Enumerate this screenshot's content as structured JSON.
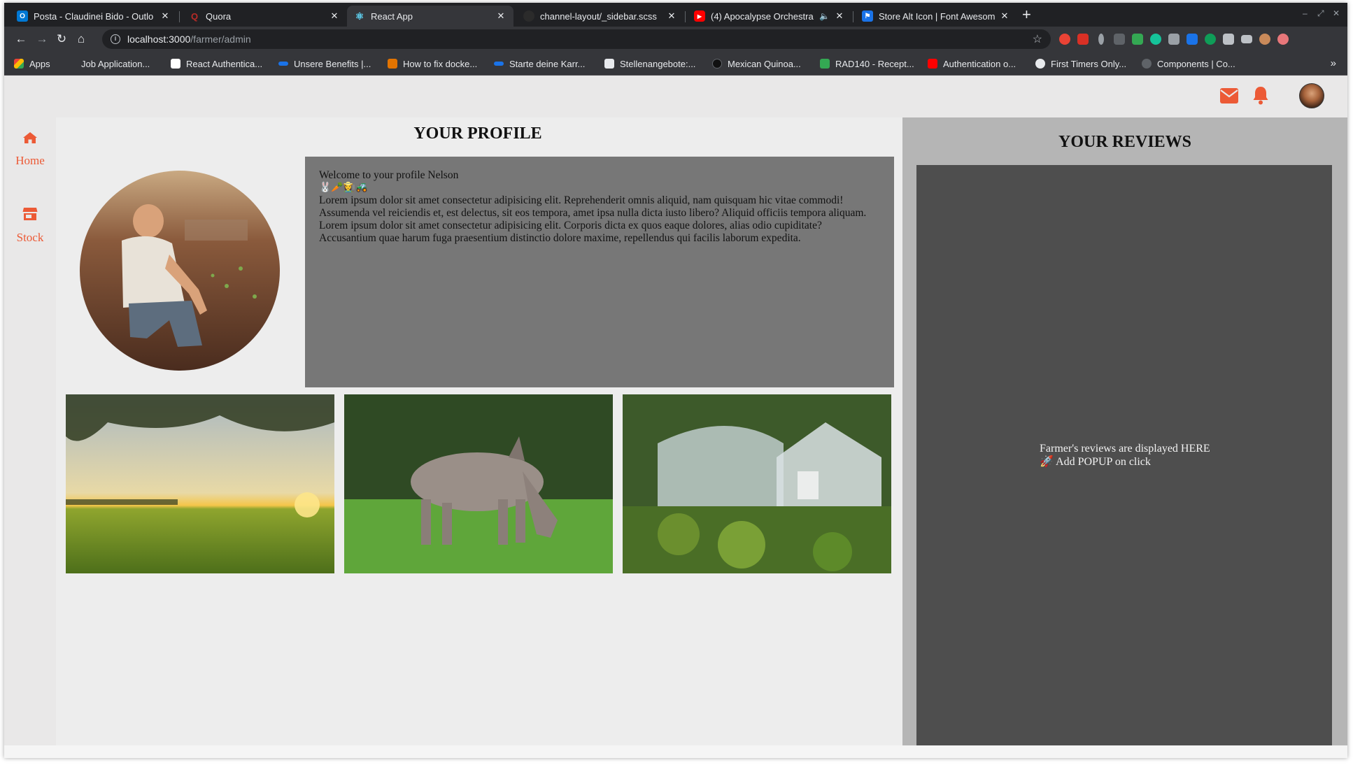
{
  "browser": {
    "tabs": [
      {
        "title": "Posta - Claudinei Bido - Outlo",
        "icon": "outlook-icon",
        "color": "#0078d4"
      },
      {
        "title": "Quora",
        "icon": "quora-icon",
        "color": "#b92b27"
      },
      {
        "title": "React App",
        "icon": "react-icon",
        "color": "#61dafb",
        "active": true
      },
      {
        "title": "channel-layout/_sidebar.scss",
        "icon": "github-icon",
        "color": "#24292e"
      },
      {
        "title": "(4) Apocalypse Orchestra",
        "icon": "youtube-icon",
        "color": "#ff0000"
      },
      {
        "title": "Store Alt Icon | Font Awesom",
        "icon": "flag-icon",
        "color": "#1a73e8"
      }
    ],
    "url_host": "localhost:3000",
    "url_path": "/farmer/admin",
    "bookmarks": [
      {
        "label": "Apps",
        "color": "#fbbc04"
      },
      {
        "label": "Job Application...",
        "color": ""
      },
      {
        "label": "React Authentica...",
        "color": "#ffffff"
      },
      {
        "label": "Unsere Benefits |...",
        "color": "#1a73e8"
      },
      {
        "label": "How to fix docke...",
        "color": "#e37400"
      },
      {
        "label": "Starte deine Karr...",
        "color": "#1a73e8"
      },
      {
        "label": "Stellenangebote:...",
        "color": "#e8eaed"
      },
      {
        "label": "Mexican Quinoa...",
        "color": "#111111"
      },
      {
        "label": "RAD140 - Recept...",
        "color": "#34a853"
      },
      {
        "label": "Authentication o...",
        "color": "#ff0000"
      },
      {
        "label": "First Timers Only...",
        "color": "#e8eaed"
      },
      {
        "label": "Components | Co...",
        "color": "#5f6368"
      }
    ]
  },
  "app": {
    "accent_color": "#ec5a36",
    "sidebar": {
      "items": [
        {
          "label": "Home",
          "icon": "home-icon"
        },
        {
          "label": "Stock",
          "icon": "store-alt-icon"
        }
      ]
    },
    "profile": {
      "title": "YOUR PROFILE",
      "welcome": "Welcome to your profile Nelson",
      "emojis": "🐰🥕👩‍🌾🚜",
      "paragraph1": "Lorem ipsum dolor sit amet consectetur adipisicing elit. Reprehenderit omnis aliquid, nam quisquam hic vitae commodi! Assumenda vel reiciendis et, est delectus, sit eos tempora, amet ipsa nulla dicta iusto libero? Aliquid officiis tempora aliquam.",
      "paragraph2": "Lorem ipsum dolor sit amet consectetur adipisicing elit. Corporis dicta ex quos eaque dolores, alias odio cupiditate? Accusantium quae harum fuga praesentium distinctio dolore maxime, repellendus qui facilis laborum expedita."
    },
    "reviews": {
      "title": "YOUR REVIEWS",
      "line1": "Farmer's reviews are displayed HERE",
      "line2_icon": "🚀",
      "line2": "Add POPUP on click"
    }
  }
}
